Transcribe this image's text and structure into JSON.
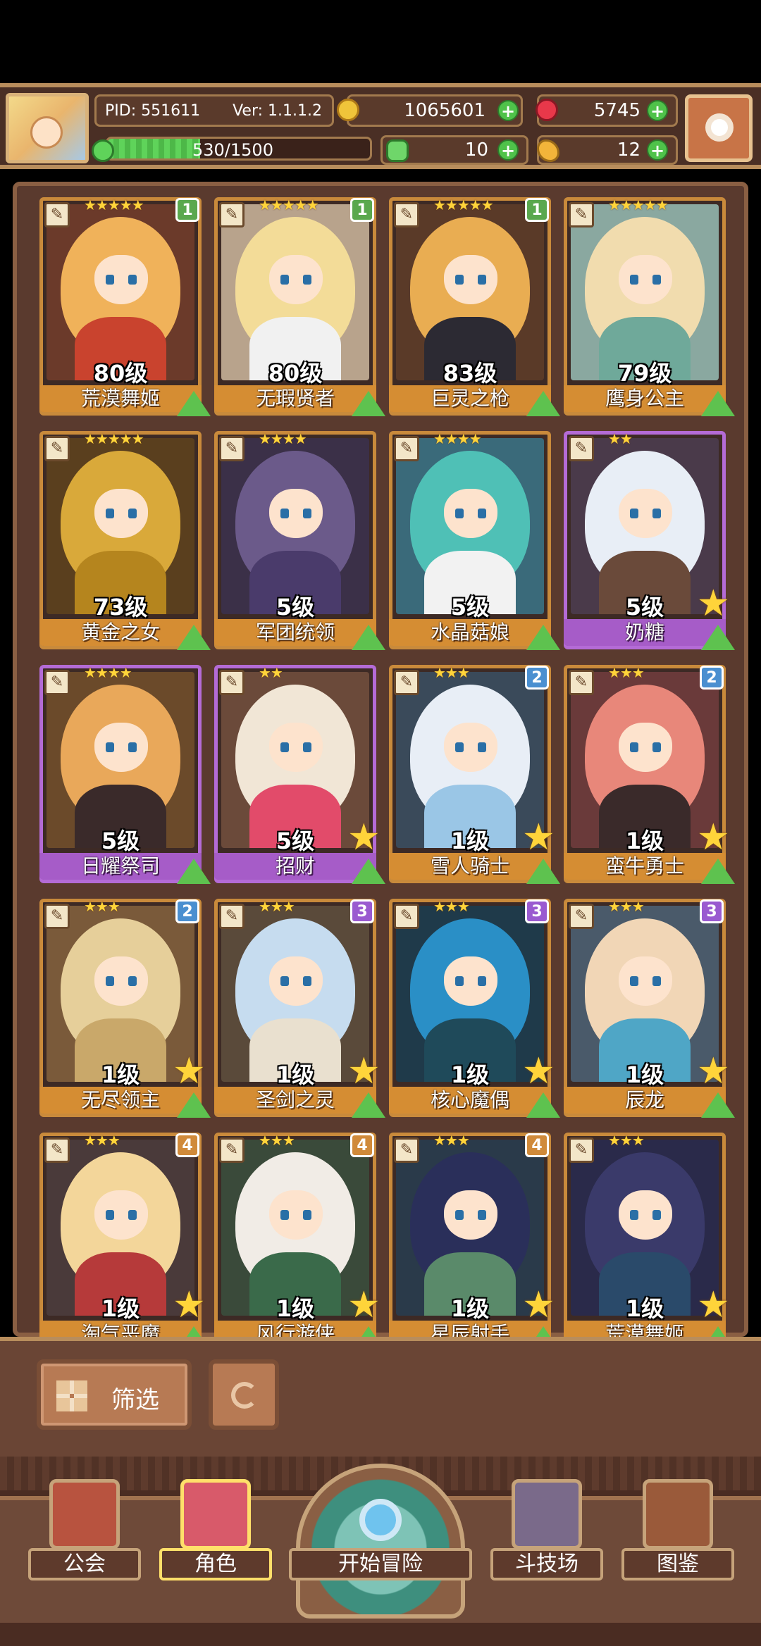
{
  "header": {
    "pid": "PID: 551611",
    "version": "Ver: 1.1.1.2",
    "gold": "1065601",
    "gems": "5745",
    "xp": "530/1500",
    "xp_fraction": 0.353,
    "clover": "10",
    "food": "12"
  },
  "cards": [
    {
      "level": "80级",
      "name": "荒漠舞姬",
      "stars": "★★★★★",
      "badge": "1",
      "badge_color": "#5aa84e",
      "border": "gold",
      "hair": "#f0b25a",
      "body": "#c9432e",
      "bg": "#6b3a2a"
    },
    {
      "level": "80级",
      "name": "无瑕贤者",
      "stars": "★★★★★",
      "badge": "1",
      "badge_color": "#5aa84e",
      "border": "gold",
      "hair": "#f3dc98",
      "body": "#f1f1f1",
      "bg": "#b8a38c"
    },
    {
      "level": "83级",
      "name": "巨灵之枪",
      "stars": "★★★★★",
      "badge": "1",
      "badge_color": "#5aa84e",
      "border": "gold",
      "hair": "#e9ad52",
      "body": "#2c2a33",
      "bg": "#5a3a28"
    },
    {
      "level": "79级",
      "name": "鹰身公主",
      "stars": "★★★★★",
      "badge": "",
      "badge_color": "",
      "border": "gold",
      "hair": "#f1dcae",
      "body": "#6fa99a",
      "bg": "#8aa8a0"
    },
    {
      "level": "73级",
      "name": "黄金之女",
      "stars": "★★★★★",
      "badge": "",
      "badge_color": "",
      "border": "gold",
      "hair": "#d9a93a",
      "body": "#b5851e",
      "bg": "#5a3f1e"
    },
    {
      "level": "5级",
      "name": "军团统领",
      "stars": "★★★★",
      "badge": "",
      "badge_color": "",
      "border": "gold",
      "hair": "#6b5a8a",
      "body": "#4a3b6b",
      "bg": "#3b3048"
    },
    {
      "level": "5级",
      "name": "水晶菇娘",
      "stars": "★★★★",
      "badge": "",
      "badge_color": "",
      "border": "gold",
      "hair": "#4fc0b6",
      "body": "#f2f2f2",
      "bg": "#3a6a7a"
    },
    {
      "level": "5级",
      "name": "奶糖",
      "stars": "★★",
      "badge": "",
      "badge_color": "",
      "border": "purple",
      "hair": "#e8eef6",
      "body": "#6a4a3a",
      "bg": "#4a3a4a",
      "fav": true
    },
    {
      "level": "5级",
      "name": "日耀祭司",
      "stars": "★★★★",
      "badge": "",
      "badge_color": "",
      "border": "purple",
      "hair": "#e9a85a",
      "body": "#3a2a2a",
      "bg": "#6b4a2a"
    },
    {
      "level": "5级",
      "name": "招财",
      "stars": "★★",
      "badge": "",
      "badge_color": "",
      "border": "purple",
      "hair": "#f1e6d6",
      "body": "#e24b6a",
      "bg": "#6b4a3a",
      "fav": true
    },
    {
      "level": "1级",
      "name": "雪人骑士",
      "stars": "★★★",
      "badge": "2",
      "badge_color": "#4a8fd0",
      "border": "gold",
      "hair": "#e8eef6",
      "body": "#9ac6e6",
      "bg": "#3a4a5a",
      "fav": true
    },
    {
      "level": "1级",
      "name": "蛮牛勇士",
      "stars": "★★★",
      "badge": "2",
      "badge_color": "#4a8fd0",
      "border": "gold",
      "hair": "#e8877a",
      "body": "#3a2a2a",
      "bg": "#6a3a3a",
      "fav": true
    },
    {
      "level": "1级",
      "name": "无尽领主",
      "stars": "★★★",
      "badge": "2",
      "badge_color": "#4a8fd0",
      "border": "gold",
      "hair": "#e6cf9a",
      "body": "#c9a86a",
      "bg": "#7a5a3a",
      "fav": true
    },
    {
      "level": "1级",
      "name": "圣剑之灵",
      "stars": "★★★",
      "badge": "3",
      "badge_color": "#9a5ad0",
      "border": "gold",
      "hair": "#c6dcef",
      "body": "#e9e0cf",
      "bg": "#5a4a3a",
      "fav": true
    },
    {
      "level": "1级",
      "name": "核心魔偶",
      "stars": "★★★",
      "badge": "3",
      "badge_color": "#9a5ad0",
      "border": "gold",
      "hair": "#2a8fc6",
      "body": "#1f4a5a",
      "bg": "#1f3a4a",
      "fav": true
    },
    {
      "level": "1级",
      "name": "辰龙",
      "stars": "★★★",
      "badge": "3",
      "badge_color": "#9a5ad0",
      "border": "gold",
      "hair": "#f1d6b6",
      "body": "#4fa6c6",
      "bg": "#4a5a6a",
      "fav": true
    },
    {
      "level": "1级",
      "name": "淘气恶魔",
      "stars": "★★★",
      "badge": "4",
      "badge_color": "#d08a3a",
      "border": "gold",
      "hair": "#f3d69a",
      "body": "#b63a3a",
      "bg": "#4a3a3a",
      "fav": true
    },
    {
      "level": "1级",
      "name": "风行游侠",
      "stars": "★★★",
      "badge": "4",
      "badge_color": "#d08a3a",
      "border": "gold",
      "hair": "#f1ece6",
      "body": "#3a6a4a",
      "bg": "#3a4a3a",
      "fav": true
    },
    {
      "level": "1级",
      "name": "星辰射手",
      "stars": "★★★",
      "badge": "4",
      "badge_color": "#d08a3a",
      "border": "gold",
      "hair": "#2a2f5a",
      "body": "#5a8a6a",
      "bg": "#2a3a4a",
      "fav": true
    },
    {
      "level": "1级",
      "name": "荒漠舞姬",
      "stars": "★★★",
      "badge": "",
      "badge_color": "",
      "border": "gold",
      "hair": "#3a3a6a",
      "body": "#2a4a6a",
      "bg": "#2a2a4a",
      "fav": true
    }
  ],
  "controls": {
    "filter_label": "筛选"
  },
  "nav": {
    "guild": "公会",
    "character": "角色",
    "adventure": "开始冒险",
    "arena": "斗技场",
    "codex": "图鉴"
  }
}
